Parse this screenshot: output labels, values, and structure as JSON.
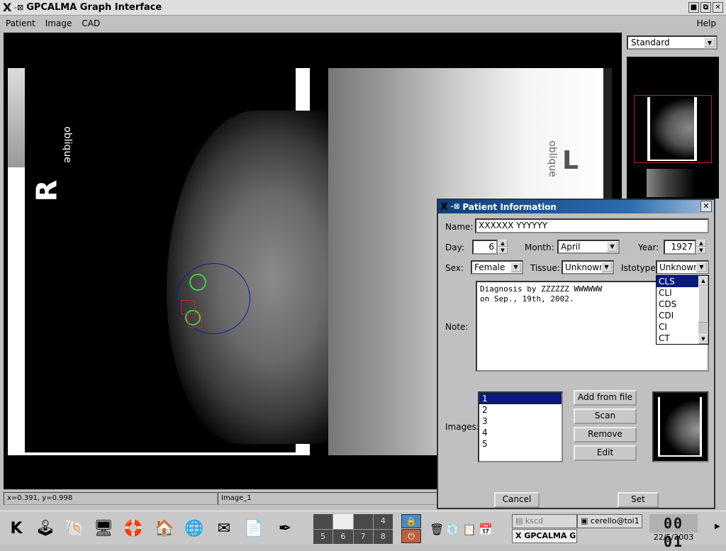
{
  "window": {
    "title": "GPCALMA Graph Interface",
    "controls": {
      "minimize": "■",
      "maximize": "⧉",
      "close": "✕"
    }
  },
  "menubar": {
    "items": [
      "Patient",
      "Image",
      "CAD"
    ],
    "help": "Help"
  },
  "viewer": {
    "left_film": {
      "side_label": "R",
      "view_label": "oblique"
    },
    "right_film": {
      "side_label": "L",
      "view_label": "oblique"
    }
  },
  "side_panel": {
    "view_mode": "Standard"
  },
  "statusbar": {
    "coords": "x=0.391, y=0.998",
    "image_name": "Image_1"
  },
  "dialog": {
    "title": "Patient Information",
    "name_label": "Name:",
    "name_value": "XXXXXX YYYYYY",
    "day_label": "Day:",
    "day_value": "6",
    "month_label": "Month:",
    "month_value": "April",
    "year_label": "Year:",
    "year_value": "1927",
    "sex_label": "Sex:",
    "sex_value": "Female",
    "tissue_label": "Tissue:",
    "tissue_value": "Unknown",
    "istotype_label": "Istotype:",
    "istotype_value": "Unknown",
    "istotype_options": [
      "CLS",
      "CLI",
      "CDS",
      "CDI",
      "CI",
      "CT"
    ],
    "istotype_highlighted": "CLS",
    "note_label": "Note:",
    "note_value": "Diagnosis by ZZZZZZ WWWWWW\non Sep., 19th, 2002.",
    "images_label": "Images:",
    "images": [
      "1",
      "2",
      "3",
      "4",
      "5"
    ],
    "images_selected": "1",
    "buttons": {
      "add_from_file": "Add from file",
      "scan": "Scan",
      "remove": "Remove",
      "edit": "Edit",
      "cancel": "Cancel",
      "set": "Set"
    }
  },
  "taskbar": {
    "launchers": [
      {
        "name": "kde-menu",
        "glyph": "K"
      },
      {
        "name": "control-center",
        "glyph": "🕹"
      },
      {
        "name": "konsole",
        "glyph": "🐚"
      },
      {
        "name": "system-monitor",
        "glyph": "🖥"
      },
      {
        "name": "help",
        "glyph": "🛟"
      },
      {
        "name": "home-folder",
        "glyph": "🏠"
      },
      {
        "name": "web-browser",
        "glyph": "🌐"
      },
      {
        "name": "mail",
        "glyph": "✉"
      },
      {
        "name": "documents",
        "glyph": "📄"
      },
      {
        "name": "text-editor",
        "glyph": "✒"
      }
    ],
    "desktops": [
      "",
      "",
      "",
      "4",
      "5",
      "6",
      "7",
      "8"
    ],
    "active_desktop": 2,
    "lock_glyph": "🔒",
    "logout_glyph": "⏻",
    "tray_icons": [
      "🗑",
      "💿",
      "📋",
      "📅"
    ],
    "tasks": [
      {
        "label": "kscd"
      },
      {
        "label": "cerello@toi1"
      },
      {
        "label": "GPCALMA G"
      }
    ],
    "clock_time": "00 01",
    "clock_date": "22/5/2003"
  }
}
